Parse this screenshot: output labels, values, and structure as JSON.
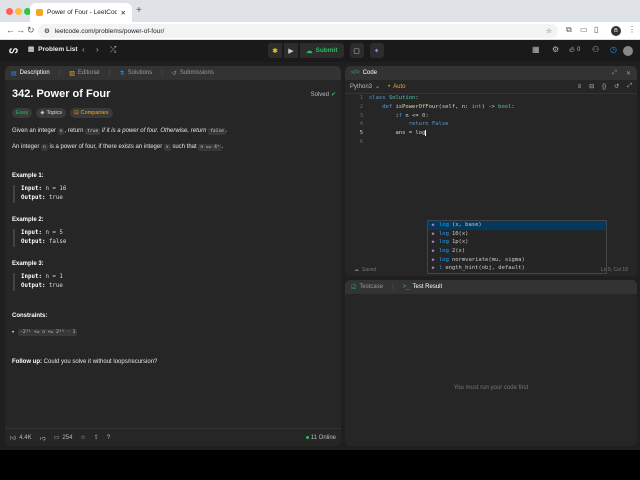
{
  "browser": {
    "tab_title": "Power of Four - LeetCode",
    "url": "leetcode.com/problems/power-of-four/",
    "profile_initial": "B",
    "traffic_colors": [
      "#ff5f57",
      "#febc2e",
      "#28c840"
    ]
  },
  "nav": {
    "problem_list": "Problem List",
    "submit": "Submit",
    "streak": "0"
  },
  "description": {
    "tabs": [
      "Description",
      "Editorial",
      "Solutions",
      "Submissions"
    ],
    "title": "342. Power of Four",
    "solved": "Solved",
    "tags": [
      "Easy",
      "Topics",
      "Companies"
    ],
    "p1": {
      "a": "Given an integer ",
      "b": "n",
      "c": ", return ",
      "d": "true",
      "e": " if it is a power of four. Otherwise, return ",
      "f": "false",
      "g": "."
    },
    "p2": {
      "a": "An integer ",
      "b": "n",
      "c": " is a power of four, if there exists an integer ",
      "d": "x",
      "e": " such that ",
      "f": "n == 4ˣ",
      "g": "."
    },
    "examples": [
      {
        "title": "Example 1:",
        "input_label": "Input:",
        "input": "n = 16",
        "output_label": "Output:",
        "output": "true"
      },
      {
        "title": "Example 2:",
        "input_label": "Input:",
        "input": "n = 5",
        "output_label": "Output:",
        "output": "false"
      },
      {
        "title": "Example 3:",
        "input_label": "Input:",
        "input": "n = 1",
        "output_label": "Output:",
        "output": "true"
      }
    ],
    "constraints_title": "Constraints:",
    "constraint": "-2³¹ <= n <= 2³¹ - 1",
    "followup_label": "Follow up:",
    "followup_text": " Could you solve it without loops/recursion?",
    "likes": "4.4K",
    "comments": "254",
    "online": "11 Online"
  },
  "code": {
    "title": "Code",
    "language": "Python3",
    "auto": "Auto",
    "line_numbers": [
      "1",
      "2",
      "3",
      "4",
      "5",
      "6"
    ],
    "saved": "Saved",
    "cursor": "Ln 5, Col 18",
    "autocomplete": [
      {
        "match": "log",
        "rest": "(x, base)"
      },
      {
        "match": "log",
        "rest": "10(x)"
      },
      {
        "match": "log",
        "rest": "1p(x)"
      },
      {
        "match": "log",
        "rest": "2(x)"
      },
      {
        "match": "log",
        "rest": "normvariate(mu, sigma)"
      },
      {
        "match": "l",
        "rest": "ength_hint(obj, default)"
      }
    ]
  },
  "testcase": {
    "tab1": "Testcase",
    "tab2": "Test Result",
    "empty": "You must run your code first"
  }
}
